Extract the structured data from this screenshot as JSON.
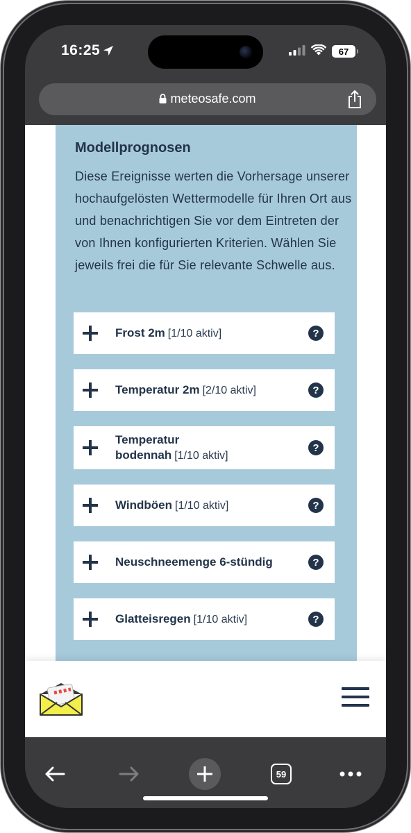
{
  "status_bar": {
    "time": "16:25",
    "battery": "67"
  },
  "browser": {
    "url": "meteosafe.com",
    "tabs_count": "59"
  },
  "section": {
    "title": "Modellprognosen",
    "description": "Diese Ereignisse werten die Vorhersage unserer hochaufgelösten Wettermodelle für Ihren Ort aus und benachrichtigen Sie vor dem Eintreten der von Ihnen konfigurierten Kriterien. Wählen Sie jeweils frei die für Sie relevante Schwelle aus."
  },
  "events": [
    {
      "name": "Frost 2m",
      "status": "[1/10 aktiv]"
    },
    {
      "name": "Temperatur 2m",
      "status": "[2/10 aktiv]"
    },
    {
      "name_line1": "Temperatur",
      "name_line2": "bodennah",
      "status": "[1/10 aktiv]"
    },
    {
      "name": "Windböen",
      "status": "[1/10 aktiv]"
    },
    {
      "name": "Neuschneemenge 6-stündig",
      "status": ""
    },
    {
      "name": "Glatteisregen",
      "status": "[1/10 aktiv]"
    }
  ],
  "help_glyph": "?",
  "colors": {
    "panel_bg": "#a7cadb",
    "text_dark": "#23344a",
    "browser_chrome": "#3b3b3d"
  },
  "icons": [
    "location-arrow-icon",
    "signal-icon",
    "wifi-icon",
    "lock-icon",
    "share-icon",
    "plus-icon",
    "help-icon",
    "envelope-logo-icon",
    "menu-icon",
    "back-icon",
    "forward-icon",
    "new-tab-icon",
    "tabs-icon",
    "more-icon"
  ]
}
